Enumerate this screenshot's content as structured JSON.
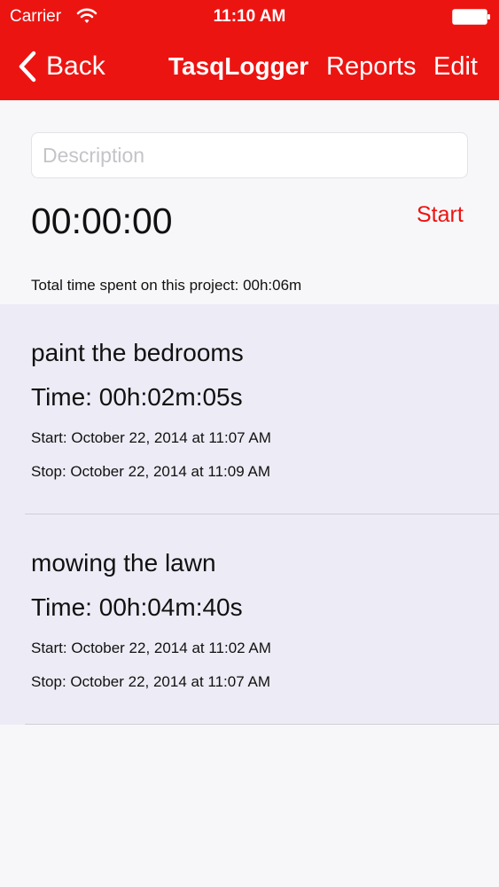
{
  "status_bar": {
    "carrier": "Carrier",
    "time": "11:10 AM"
  },
  "nav": {
    "back_label": "Back",
    "title": "TasqLogger",
    "reports_label": "Reports",
    "edit_label": "Edit"
  },
  "form": {
    "description_placeholder": "Description",
    "description_value": ""
  },
  "timer": {
    "display": "00:00:00",
    "start_label": "Start"
  },
  "total_time": "Total time spent on this project: 00h:06m",
  "tasks": [
    {
      "name": "paint the bedrooms",
      "duration": "Time: 00h:02m:05s",
      "start": "Start: October 22, 2014 at 11:07 AM",
      "stop": "Stop: October 22, 2014 at 11:09 AM"
    },
    {
      "name": "mowing the lawn",
      "duration": "Time: 00h:04m:40s",
      "start": "Start: October 22, 2014 at 11:02 AM",
      "stop": "Stop: October 22, 2014 at 11:07 AM"
    }
  ],
  "colors": {
    "accent": "#ec1411",
    "row_background": "#edecf6",
    "page_background": "#f7f7f9"
  },
  "icons": {
    "wifi": "wifi-icon",
    "battery": "battery-icon",
    "back": "chevron-left-icon"
  }
}
